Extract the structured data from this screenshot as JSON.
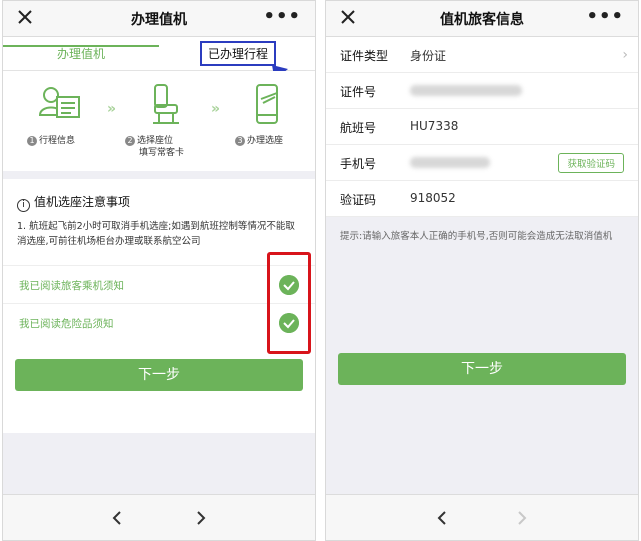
{
  "left": {
    "header": {
      "title": "办理值机",
      "more": "•••"
    },
    "tabs": {
      "active": "办理值机",
      "other": "已办理行程"
    },
    "steps": [
      {
        "num": "1",
        "label": "行程信息",
        "icon": "user-card-icon"
      },
      {
        "num": "2",
        "label": "选择座位",
        "label2": "填写常客卡",
        "icon": "seat-icon"
      },
      {
        "num": "3",
        "label": "办理选座",
        "icon": "phone-check-icon"
      }
    ],
    "step_arrows": "»",
    "notice": {
      "title": "值机选座注意事项",
      "info_icon": "i",
      "text": "1. 航班起飞前2小时可取消手机选座;如遇到航班控制等情况不能取消选座,可前往机场柜台办理或联系航空公司"
    },
    "checks": [
      {
        "label": "我已阅读旅客乘机须知"
      },
      {
        "label": "我已阅读危险品须知"
      }
    ],
    "next_button": "下一步",
    "colors": {
      "accent": "#6cb35a",
      "highlight_box": "#d8141b",
      "tab_highlight": "#2b3cbf"
    }
  },
  "right": {
    "header": {
      "title": "值机旅客信息",
      "more": "•••"
    },
    "form": {
      "id_type_label": "证件类型",
      "id_type_value": "身份证",
      "id_no_label": "证件号",
      "flight_label": "航班号",
      "flight_value": "HU7338",
      "phone_label": "手机号",
      "get_code_button": "获取验证码",
      "code_label": "验证码",
      "code_value": "918052"
    },
    "tip": "提示:请输入旅客本人正确的手机号,否则可能会造成无法取消值机",
    "next_button": "下一步"
  }
}
